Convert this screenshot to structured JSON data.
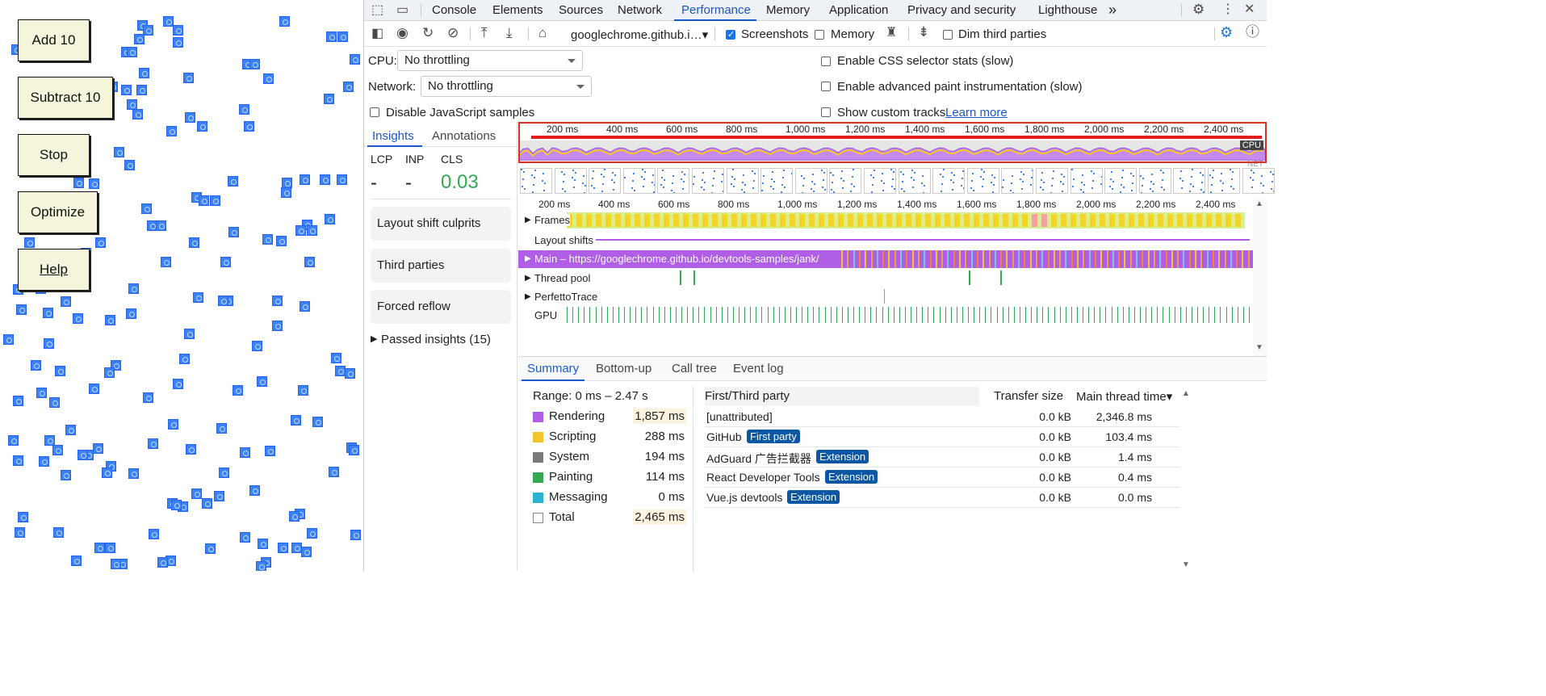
{
  "demo": {
    "buttons": [
      "Add 10",
      "Subtract 10",
      "Stop",
      "Optimize",
      "Help"
    ]
  },
  "devtools": {
    "tabs": [
      "Console",
      "Elements",
      "Sources",
      "Network",
      "Performance",
      "Memory",
      "Application",
      "Privacy and security",
      "Lighthouse"
    ],
    "active_tab": "Performance",
    "more_tabs": "»",
    "toolbar": {
      "profile_select": "googlechrome.github.i…▾",
      "screenshots_label": "Screenshots",
      "screenshots_checked": true,
      "memory_label": "Memory",
      "memory_checked": false,
      "dim_label": "Dim third parties",
      "dim_checked": false
    },
    "settings": {
      "cpu_label": "CPU:",
      "cpu_value": "No throttling",
      "network_label": "Network:",
      "network_value": "No throttling",
      "disable_js": "Disable JavaScript samples",
      "css_stats": "Enable CSS selector stats (slow)",
      "paint_instr": "Enable advanced paint instrumentation (slow)",
      "custom_tracks": "Show custom tracks",
      "learn_more": "Learn more"
    },
    "sidebar": {
      "tabs": [
        "Insights",
        "Annotations"
      ],
      "metrics": [
        {
          "label": "LCP",
          "value": "-"
        },
        {
          "label": "INP",
          "value": "-"
        },
        {
          "label": "CLS",
          "value": "0.03"
        }
      ],
      "cards": [
        "Layout shift culprits",
        "Third parties",
        "Forced reflow"
      ],
      "passed": "Passed insights (15)"
    },
    "timeline": {
      "ticks": [
        "200 ms",
        "400 ms",
        "600 ms",
        "800 ms",
        "1,000 ms",
        "1,200 ms",
        "1,400 ms",
        "1,600 ms",
        "1,800 ms",
        "2,000 ms",
        "2,200 ms",
        "2,400 ms"
      ],
      "overview_labels": [
        "CPU",
        "NET"
      ],
      "tracks": [
        "Frames",
        "Layout shifts",
        "Main – https://googlechrome.github.io/devtools-samples/jank/",
        "Thread pool",
        "PerfettoTrace",
        "GPU"
      ]
    },
    "bottom": {
      "tabs": [
        "Summary",
        "Bottom-up",
        "Call tree",
        "Event log"
      ],
      "range": "Range: 0 ms – 2.47 s",
      "summary": [
        {
          "label": "Rendering",
          "value": "1,857 ms",
          "color": "#b05ee6"
        },
        {
          "label": "Scripting",
          "value": "288 ms",
          "color": "#f2c52b"
        },
        {
          "label": "System",
          "value": "194 ms",
          "color": "#7a7a7a"
        },
        {
          "label": "Painting",
          "value": "114 ms",
          "color": "#34a853"
        },
        {
          "label": "Messaging",
          "value": "0 ms",
          "color": "#2bb3d6"
        },
        {
          "label": "Total",
          "value": "2,465 ms",
          "color": "#ffffff"
        }
      ],
      "table": {
        "headers": [
          "First/Third party",
          "Transfer size",
          "Main thread time▾"
        ],
        "rows": [
          {
            "name": "[unattributed]",
            "badge": "",
            "size": "0.0 kB",
            "time": "2,346.8 ms"
          },
          {
            "name": "GitHub",
            "badge": "First party",
            "size": "0.0 kB",
            "time": "103.4 ms"
          },
          {
            "name": "AdGuard 广告拦截器",
            "badge": "Extension",
            "size": "0.0 kB",
            "time": "1.4 ms"
          },
          {
            "name": "React Developer Tools",
            "badge": "Extension",
            "size": "0.0 kB",
            "time": "0.4 ms"
          },
          {
            "name": "Vue.js devtools",
            "badge": "Extension",
            "size": "0.0 kB",
            "time": "0.0 ms"
          }
        ]
      }
    }
  }
}
